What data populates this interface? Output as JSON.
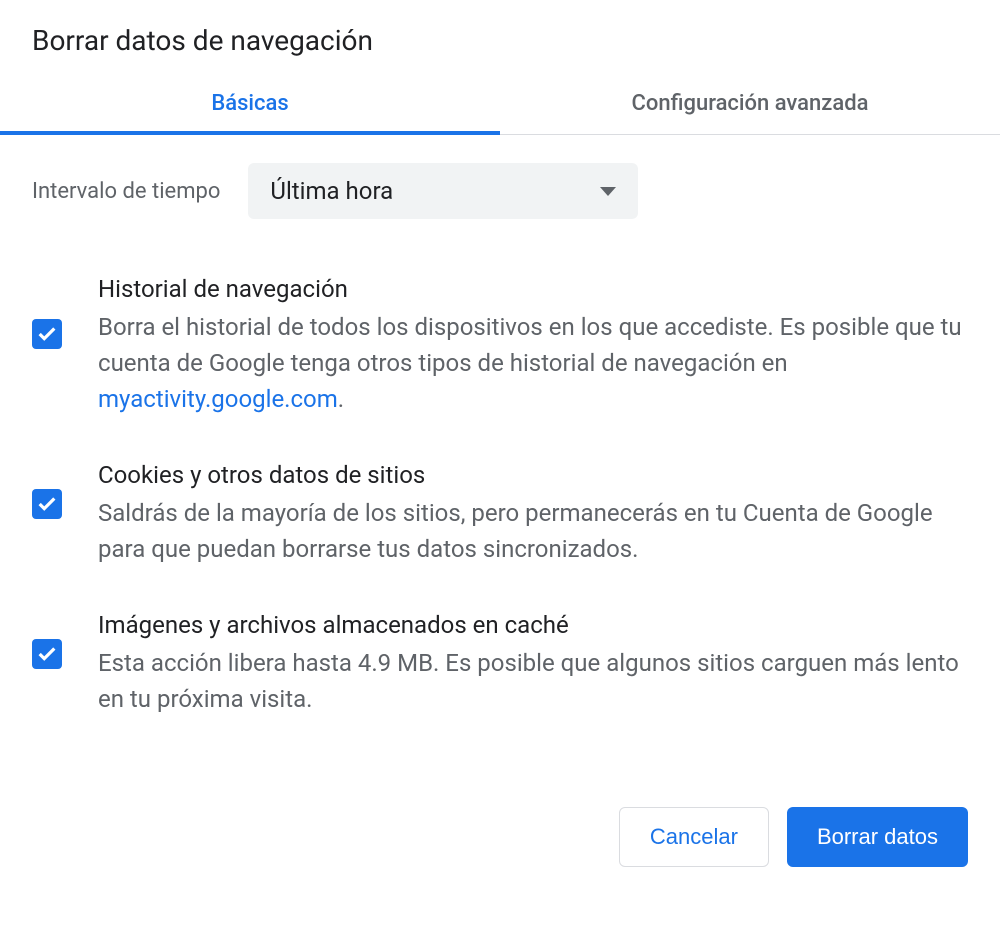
{
  "title": "Borrar datos de navegación",
  "tabs": {
    "basic": "Básicas",
    "advanced": "Configuración avanzada"
  },
  "timeRange": {
    "label": "Intervalo de tiempo",
    "value": "Última hora"
  },
  "options": {
    "history": {
      "title": "Historial de navegación",
      "desc_part1": "Borra el historial de todos los dispositivos en los que accediste. Es posible que tu cuenta de Google tenga otros tipos de historial de navegación en ",
      "link": "myactivity.google.com",
      "desc_part2": "."
    },
    "cookies": {
      "title": "Cookies y otros datos de sitios",
      "desc": "Saldrás de la mayoría de los sitios, pero permanecerás en tu Cuenta de Google para que puedan borrarse tus datos sincronizados."
    },
    "cache": {
      "title": "Imágenes y archivos almacenados en caché",
      "desc": "Esta acción libera hasta 4.9 MB. Es posible que algunos sitios carguen más lento en tu próxima visita."
    }
  },
  "buttons": {
    "cancel": "Cancelar",
    "clear": "Borrar datos"
  }
}
